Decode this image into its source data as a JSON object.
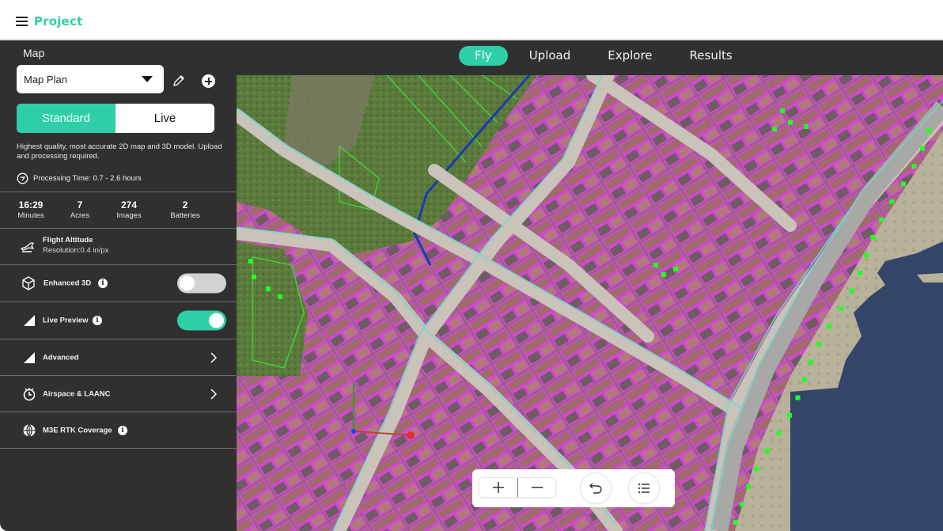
{
  "header": {
    "menu_icon": "hamburger-menu-icon",
    "project_title": "Project"
  },
  "nav": {
    "tabs": [
      {
        "label": "Fly",
        "active": true
      },
      {
        "label": "Upload",
        "active": false
      },
      {
        "label": "Explore",
        "active": false
      },
      {
        "label": "Results",
        "active": false
      }
    ]
  },
  "sidebar": {
    "section_title": "Map",
    "map_select": {
      "value": "Map Plan",
      "icon": "caret-down-icon"
    },
    "edit_icon": "pencil-icon",
    "add_icon": "plus-circle-icon",
    "mode_toggle": {
      "options": [
        "Standard",
        "Live"
      ],
      "selected": "Standard"
    },
    "description": "Highest quality, most accurate 2D map and 3D model. Upload and processing required.",
    "processing_time": "Processing Time: 0.7 - 2.6 hours",
    "stats": [
      {
        "value": "16:29",
        "label": "Minutes"
      },
      {
        "value": "7",
        "label": "Acres"
      },
      {
        "value": "274",
        "label": "Images"
      },
      {
        "value": "2",
        "label": "Batteries"
      }
    ],
    "flight_altitude": {
      "title": "Flight Altitude",
      "subtitle": "Resolution:0.4 in/px"
    },
    "options": [
      {
        "label": "Enhanced 3D",
        "icon": "cube-icon",
        "info": true,
        "toggle": false
      },
      {
        "label": "Live Preview",
        "icon": "triangle-icon",
        "info": true,
        "toggle": true
      },
      {
        "label": "Advanced",
        "icon": "triangle-icon",
        "chevron": true
      },
      {
        "label": "Airspace & LAANC",
        "icon": "airspace-clock-icon",
        "chevron": true
      },
      {
        "label": "M3E RTK Coverage",
        "icon": "globe-icon",
        "info": true
      }
    ],
    "info_glyph": "i"
  },
  "map": {
    "description": "Aerial satellite imagery with building (magenta), road (cyan), vegetation (green) and water overlays",
    "colors": {
      "building_outline": "#e040e8",
      "road_outline": "#6fd8d0",
      "vegetation_outline": "#3ddc3d",
      "tree_marker": "#22ff22",
      "water": "#34456a",
      "river_line": "#1a3ab0"
    },
    "controls": {
      "zoom_in": "plus-icon",
      "zoom_out": "minus-icon",
      "undo": "undo-icon",
      "layers": "list-icon"
    }
  },
  "colors": {
    "accent": "#2ecfa7",
    "sidebar_bg": "#303030",
    "header_bg": "#ffffff"
  }
}
